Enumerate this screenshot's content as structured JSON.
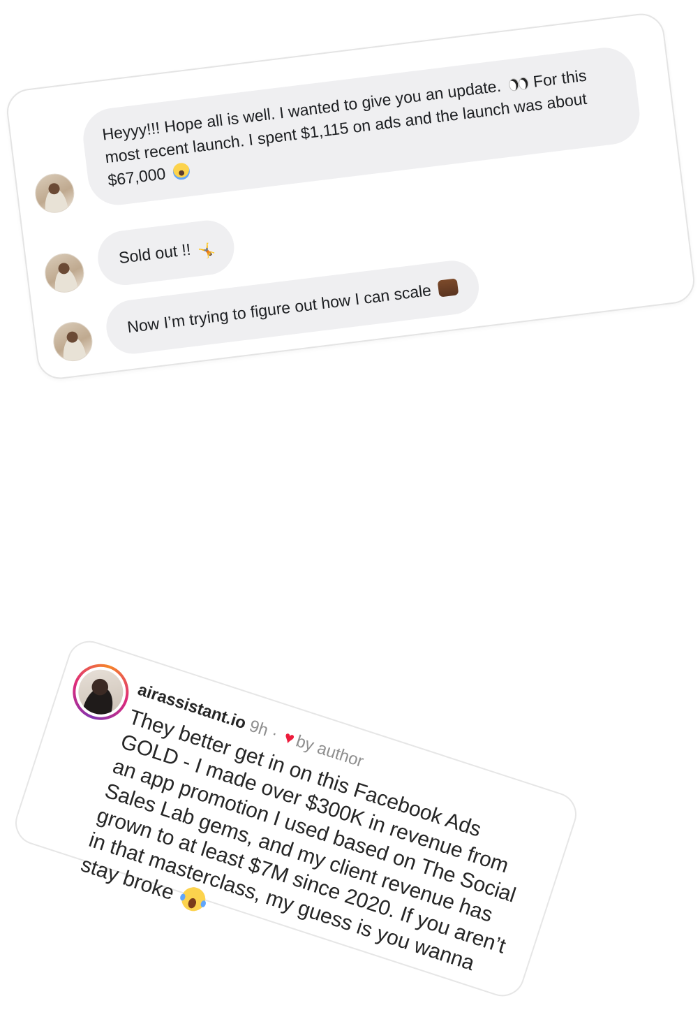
{
  "dm": {
    "messages": [
      {
        "text": "Heyyy!!! Hope all is well. I wanted to give you an update.",
        "text_after_eyes": " For this most recent launch. I spent $1,115 on ads and the launch was about $67,000",
        "emojis": [
          "eyes-emoji",
          "scream-emoji"
        ]
      },
      {
        "text": "Sold out !!",
        "emojis": [
          "cartwheel-emoji"
        ]
      },
      {
        "text": "Now I’m trying to figure out how I can scale",
        "emojis": [
          "raised-hands-emoji"
        ]
      }
    ]
  },
  "comment": {
    "username": "airassistant.io",
    "time": "9h",
    "separator": "·",
    "liked_by": "by author",
    "text": "They better get in on this Facebook Ads GOLD - I made over $300K in revenue from an app promotion I used based on The Social Sales Lab gems, and my client revenue has grown to at least $7M since 2020. If you aren’t in that masterclass, my guess is you wanna stay broke",
    "emoji": "laughing-tears-emoji",
    "heart_color": "#ed1c3c"
  },
  "colors": {
    "bubble": "#efeff1",
    "card_border": "#e4e4e4",
    "muted_text": "#8e8e8e"
  }
}
